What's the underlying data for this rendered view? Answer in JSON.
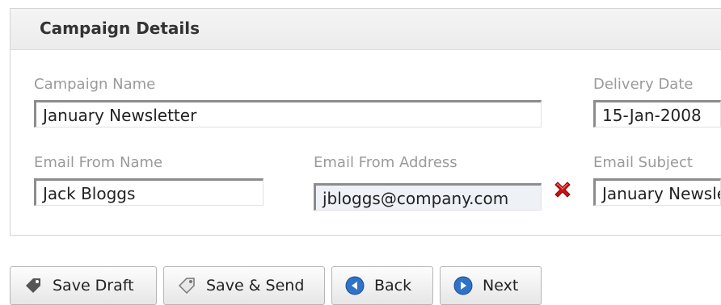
{
  "panel": {
    "title": "Campaign Details"
  },
  "fields": {
    "campaign_name": {
      "label": "Campaign Name",
      "value": "January Newsletter"
    },
    "delivery_date": {
      "label": "Delivery Date",
      "value": "15-Jan-2008"
    },
    "email_from_name": {
      "label": "Email From Name",
      "value": "Jack Bloggs"
    },
    "email_from_address": {
      "label": "Email From Address",
      "value": "jbloggs@company.com",
      "error_icon": "red-x-icon"
    },
    "email_subject": {
      "label": "Email Subject",
      "value": "January Newsletter"
    }
  },
  "buttons": {
    "save_draft": {
      "label": "Save Draft",
      "icon": "tag-icon"
    },
    "save_send": {
      "label": "Save & Send",
      "icon": "tag-outline-icon"
    },
    "back": {
      "label": "Back",
      "icon": "arrow-left-circle-icon"
    },
    "next": {
      "label": "Next",
      "icon": "arrow-right-circle-icon"
    }
  },
  "colors": {
    "error": "#cc1111",
    "nav_icon_blue": "#2e73c8",
    "label_gray": "#9a9a9a"
  }
}
